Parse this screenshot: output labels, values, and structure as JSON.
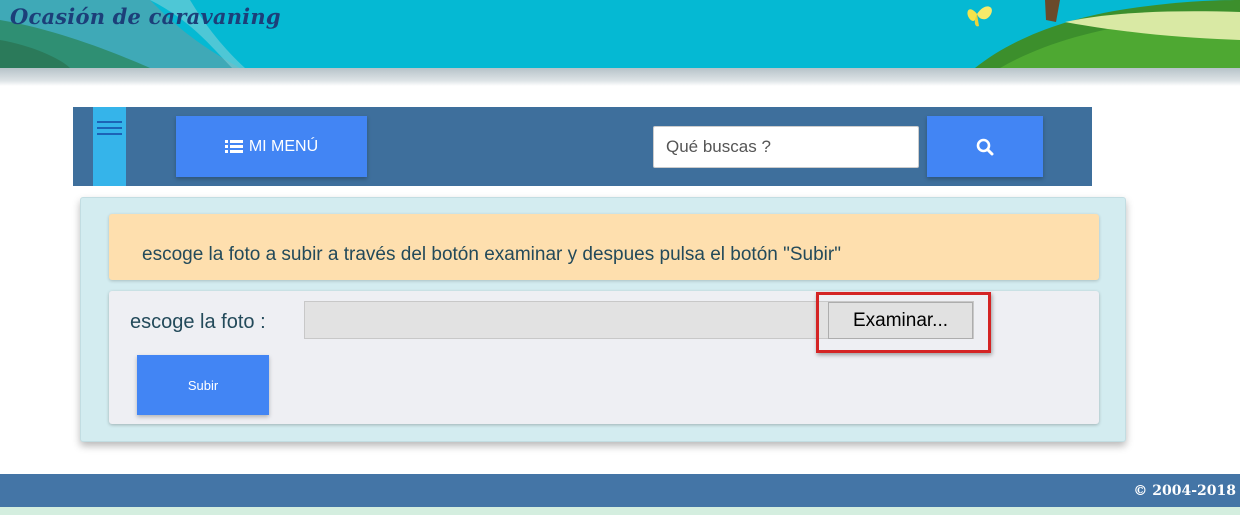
{
  "header": {
    "site_title": "Ocasión de caravaning"
  },
  "nav": {
    "menu_label": "MI MENÚ",
    "search_placeholder": "Qué buscas ?"
  },
  "notice": {
    "text": "escoge la foto a subir a través del botón examinar y despues pulsa el botón \"Subir\""
  },
  "upload_form": {
    "label": "escoge la foto :",
    "browse_label": "Examinar...",
    "submit_label": "Subir"
  },
  "footer": {
    "copyright": "© 2004-2018"
  },
  "colors": {
    "banner": "#05b9d3",
    "navbar": "#3e6f9c",
    "accent_button": "#4285f4",
    "notice_bg": "#fedfae",
    "panel_bg": "#d3ecf0",
    "highlight": "#d42424",
    "footer": "#4475a6"
  },
  "icons": {
    "menu_toggle": "hamburger-icon",
    "menu_button": "list-icon",
    "search_button": "search-icon"
  }
}
